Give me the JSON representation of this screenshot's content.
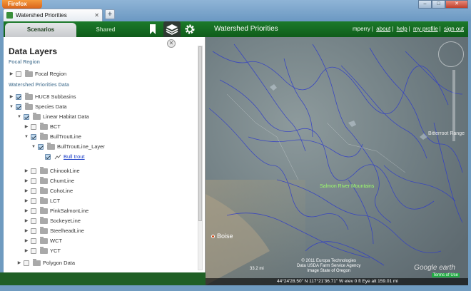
{
  "browser": {
    "menu_label": "Firefox",
    "tab_title": "Watershed Priorities",
    "new_tab_label": "+"
  },
  "header": {
    "tabs": [
      {
        "label": "Scenarios"
      },
      {
        "label": "Shared"
      }
    ],
    "app_title": "Watershed Priorities",
    "username": "mperry",
    "links": [
      {
        "label": "about"
      },
      {
        "label": "help"
      },
      {
        "label": "my profile"
      },
      {
        "label": "sign out"
      }
    ],
    "accent": "#1c7a2a"
  },
  "panel": {
    "title": "Data Layers",
    "sections": [
      {
        "title": "Focal Region"
      },
      {
        "title": "Watershed Priorities Data"
      }
    ],
    "rows": [
      {
        "label": "Focal Region"
      },
      {
        "label": "HUC8 Subbasins"
      },
      {
        "label": "Species Data"
      },
      {
        "label": "Linear Habitat Data"
      },
      {
        "label": "BCT"
      },
      {
        "label": "BullTroutLine"
      },
      {
        "label": "BullTroutLine_Layer"
      },
      {
        "label": "Bull trout"
      },
      {
        "label": "ChinookLine"
      },
      {
        "label": "ChumLine"
      },
      {
        "label": "CohoLine"
      },
      {
        "label": "LCT"
      },
      {
        "label": "PinkSalmonLine"
      },
      {
        "label": "SockeyeLine"
      },
      {
        "label": "SteelheadLine"
      },
      {
        "label": "WCT"
      },
      {
        "label": "YCT"
      },
      {
        "label": "Polygon Data"
      }
    ]
  },
  "map": {
    "labels": [
      {
        "text": "Bitterroot Range"
      },
      {
        "text": "Salmon River Mountains"
      }
    ],
    "city": "Boise",
    "scale": "33.2 mi",
    "copyright": [
      "© 2011 Europa Technologies",
      "Data USDA Farm Service Agency",
      "Image State of Oregon"
    ],
    "google": "Google earth",
    "terms": "Terms of Use",
    "status": "44°24'28.50\" N 117°21'36.71\" W  elev 0 ft        Eye alt 159.01 mi"
  }
}
